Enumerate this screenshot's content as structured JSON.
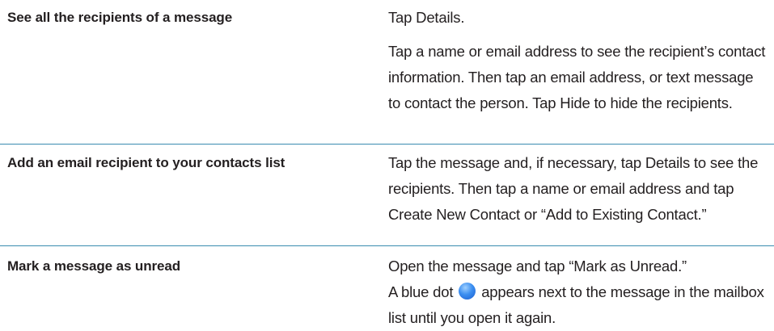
{
  "rows": [
    {
      "task": "See all the recipients of a message",
      "description_1": "Tap Details.",
      "description_2": "Tap a name or email address to see the recipient’s contact information. Then tap an email address, or text message to contact the person. Tap Hide to hide the recipients."
    },
    {
      "task": "Add an email recipient to your contacts list",
      "description_1": "Tap the message and, if necessary, tap Details to see the recipients. Then tap a name or email address and tap Create New Contact or “Add to Existing Contact.”"
    },
    {
      "task": "Mark a message as unread",
      "description_1": "Open the message and tap “Mark as Unread.”",
      "description_2_before": "A blue dot",
      "description_2_after": "appears next to the message in the mailbox list until you open it again."
    }
  ],
  "icons": {
    "unread_dot": "blue-dot-icon"
  },
  "colors": {
    "divider": "#3a8cb0",
    "text": "#231f20",
    "unread_dot": "#3b8ef0"
  }
}
